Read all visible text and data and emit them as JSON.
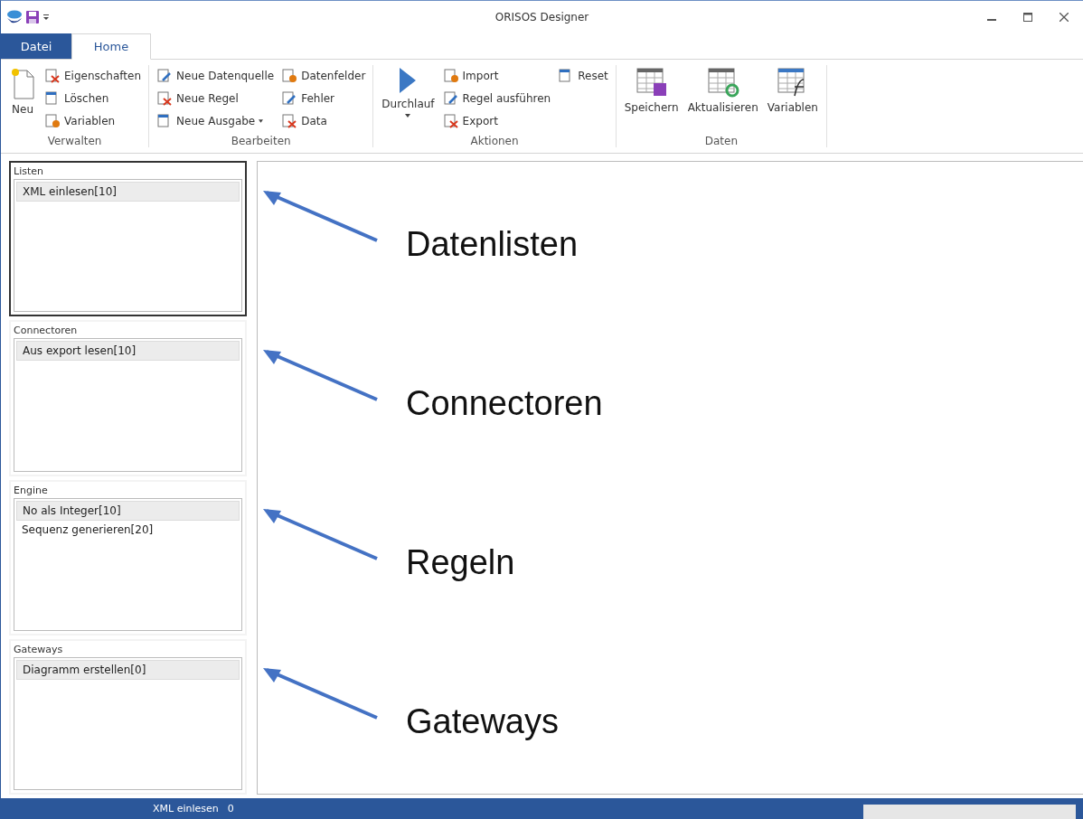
{
  "window": {
    "title": "ORISOS Designer"
  },
  "tabs": [
    {
      "label": "Datei",
      "kind": "file",
      "selected": false
    },
    {
      "label": "Home",
      "kind": "tab",
      "selected": true
    }
  ],
  "ribbon": [
    {
      "label": "Verwalten",
      "columns": [
        [
          {
            "label": "Neu",
            "kind": "large",
            "dropdown": false
          }
        ],
        [
          {
            "label": "Eigenschaften",
            "kind": "small",
            "dropdown": false
          },
          {
            "label": "Löschen",
            "kind": "small",
            "dropdown": false
          },
          {
            "label": "Variablen",
            "kind": "small",
            "dropdown": false
          }
        ]
      ]
    },
    {
      "label": "Bearbeiten",
      "columns": [
        [
          {
            "label": "Neue Datenquelle",
            "kind": "small",
            "dropdown": false
          },
          {
            "label": "Neue Regel",
            "kind": "small",
            "dropdown": false
          },
          {
            "label": "Neue Ausgabe",
            "kind": "small",
            "dropdown": true
          }
        ],
        [
          {
            "label": "Datenfelder",
            "kind": "small",
            "dropdown": false
          },
          {
            "label": "Fehler",
            "kind": "small",
            "dropdown": false
          },
          {
            "label": "Data",
            "kind": "small",
            "dropdown": false
          }
        ]
      ]
    },
    {
      "label": "Aktionen",
      "columns": [
        [
          {
            "label": "Durchlauf",
            "kind": "large",
            "dropdown": true
          }
        ],
        [
          {
            "label": "Import",
            "kind": "small",
            "dropdown": false
          },
          {
            "label": "Regel ausführen",
            "kind": "small",
            "dropdown": false
          },
          {
            "label": "Export",
            "kind": "small",
            "dropdown": false
          }
        ],
        [
          {
            "label": "Reset",
            "kind": "small",
            "dropdown": false
          }
        ]
      ]
    },
    {
      "label": "Daten",
      "columns": [
        [
          {
            "label": "Speichern",
            "kind": "large",
            "dropdown": false
          }
        ],
        [
          {
            "label": "Aktualisieren",
            "kind": "large",
            "dropdown": false
          }
        ],
        [
          {
            "label": "Variablen",
            "kind": "large",
            "dropdown": false
          }
        ]
      ]
    }
  ],
  "panels": [
    {
      "title": "Listen",
      "selected": true,
      "items": [
        {
          "label": "XML einlesen[10]",
          "selected": true
        }
      ]
    },
    {
      "title": "Connectoren",
      "selected": false,
      "items": [
        {
          "label": "Aus export lesen[10]",
          "selected": true
        }
      ]
    },
    {
      "title": "Engine",
      "selected": false,
      "items": [
        {
          "label": "No als Integer[10]",
          "selected": true
        },
        {
          "label": "Sequenz generieren[20]",
          "selected": false
        }
      ]
    },
    {
      "title": "Gateways",
      "selected": false,
      "items": [
        {
          "label": "Diagramm erstellen[0]",
          "selected": true
        }
      ]
    }
  ],
  "annotations": [
    "Datenlisten",
    "Connectoren",
    "Regeln",
    "Gateways"
  ],
  "status_bar": {
    "item": "XML einlesen",
    "count": "0",
    "progress": {
      "level": 0
    }
  }
}
